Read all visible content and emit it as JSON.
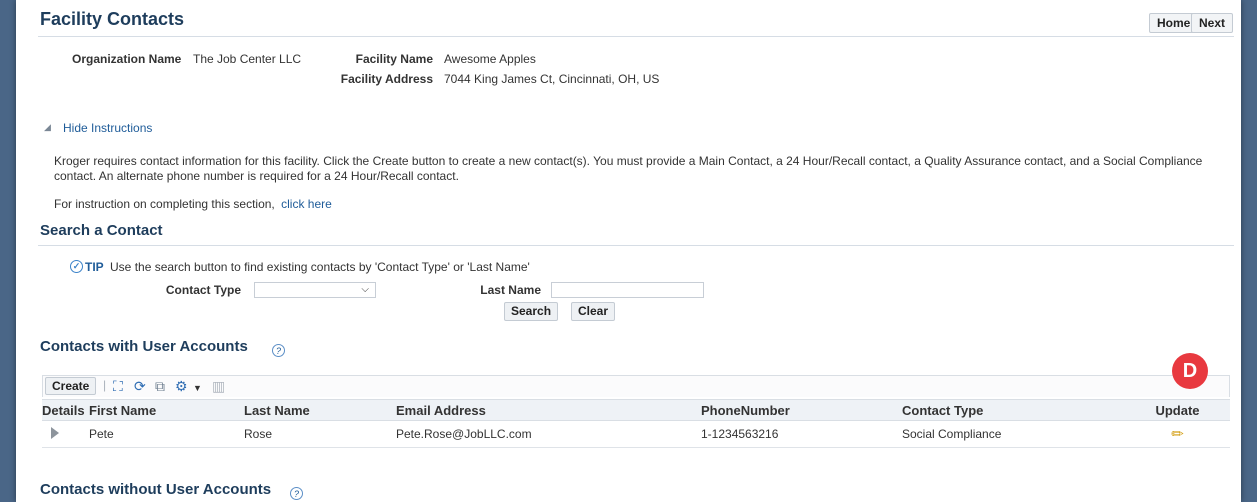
{
  "page": {
    "title": "Facility Contacts",
    "home_label": "Home",
    "next_label": "Next"
  },
  "info": {
    "org_label": "Organization Name",
    "org_value": "The Job Center LLC",
    "facility_label": "Facility Name",
    "facility_value": "Awesome Apples",
    "address_label": "Facility Address",
    "address_value": "7044 King James Ct, Cincinnati, OH, US"
  },
  "instructions": {
    "toggle_label": "Hide Instructions",
    "text": "Kroger requires contact information for this facility. Click the Create button to create a new contact(s). You must provide a Main Contact, a 24 Hour/Recall contact, a Quality Assurance contact, and a Social Compliance contact. An alternate phone number is required for a 24 Hour/Recall contact.",
    "more_text": "For instruction on completing this section,",
    "more_link": "click here"
  },
  "search": {
    "title": "Search a Contact",
    "tip_label": "TIP",
    "tip_text": "Use the search button to find existing contacts by 'Contact Type' or 'Last Name'",
    "contact_type_label": "Contact Type",
    "contact_type_value": "",
    "last_name_label": "Last Name",
    "last_name_value": "",
    "search_button": "Search",
    "clear_button": "Clear"
  },
  "with_accounts": {
    "title": "Contacts with User Accounts",
    "create_button": "Create",
    "columns": [
      "Details",
      "First Name",
      "Last Name",
      "Email Address",
      "PhoneNumber",
      "Contact Type",
      "Update"
    ],
    "rows": [
      {
        "first_name": "Pete",
        "last_name": "Rose",
        "email": "Pete.Rose@JobLLC.com",
        "phone": "1-1234563216",
        "contact_type": "Social Compliance"
      }
    ]
  },
  "without_accounts": {
    "title": "Contacts without User Accounts"
  },
  "marker": {
    "label": "D",
    "color": "#e8393f"
  },
  "icons": [
    "collapse-arrow-icon",
    "tip-icon",
    "help-icon",
    "detach-icon",
    "refresh-icon",
    "export-icon",
    "settings-icon",
    "columns-icon",
    "expand-row-icon",
    "pencil-icon"
  ]
}
